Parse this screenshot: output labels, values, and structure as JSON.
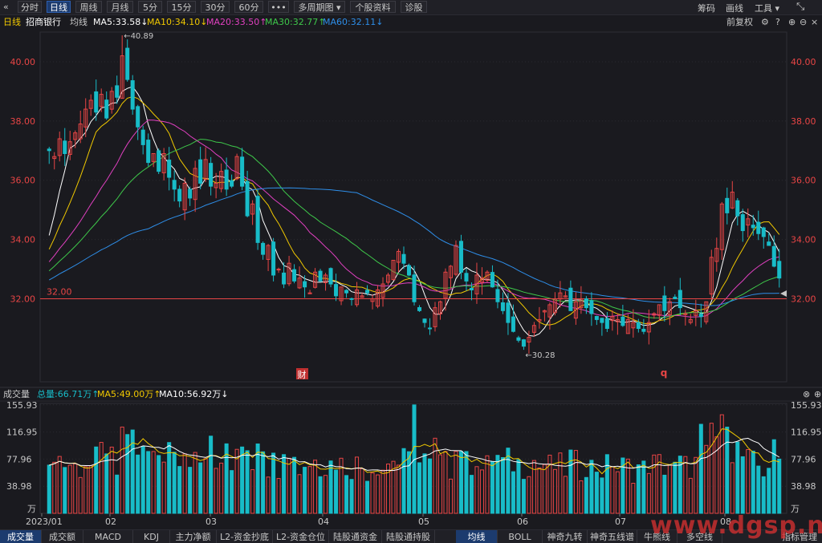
{
  "toolbar": {
    "back_icon": "double-chevron-left-icon",
    "buttons": [
      {
        "label": "分时"
      },
      {
        "label": "日线"
      },
      {
        "label": "周线"
      },
      {
        "label": "月线"
      },
      {
        "label": "5分"
      },
      {
        "label": "15分"
      },
      {
        "label": "30分"
      },
      {
        "label": "60分"
      },
      {
        "label": "•••"
      },
      {
        "label": "多周期图 ▾"
      },
      {
        "label": "个股资料"
      },
      {
        "label": "诊股"
      }
    ],
    "right": {
      "chips": "筹码",
      "draw": "画线",
      "tools": "工具 ▾"
    }
  },
  "stock": {
    "period": "日线",
    "name": "招商银行",
    "ma_label": "均线",
    "ma5": "MA5:33.58↓",
    "ma10": "MA10:34.10↓",
    "ma20": "MA20:33.50↑",
    "ma30": "MA30:32.77↑",
    "ma60": "MA60:32.11↓",
    "fq": "前复权",
    "colors": {
      "ma5": "#ffffff",
      "ma10": "#f0c800",
      "ma20": "#e040c0",
      "ma30": "#3ec84a",
      "ma60": "#2e8ee8",
      "up": "#e84545",
      "down": "#18bcc8"
    }
  },
  "volume_header": {
    "title": "成交量",
    "total": "总量:66.71万↑",
    "ma5": "MA5:49.00万↑",
    "ma10": "MA10:56.92万↓"
  },
  "annotations": {
    "high": "←40.89",
    "low": "←30.28",
    "level": "32.00",
    "cai": "财",
    "q": "q"
  },
  "bottom_tabs": {
    "left": [
      "成交量",
      "成交额",
      "MACD",
      "KDJ",
      "主力净额",
      "L2-资金抄底",
      "L2-资金仓位",
      "陆股通资金",
      "陆股通持股"
    ],
    "right": [
      "均线",
      "BOLL",
      "神奇九转",
      "神奇五线谱",
      "牛熊线",
      "多空线"
    ],
    "settings": "指标管理"
  },
  "watermark": "www.dgsp.net",
  "chart_data": {
    "type": "candlestick",
    "title": "招商银行 日线",
    "x_ticks": [
      "2023/01",
      "02",
      "03",
      "04",
      "05",
      "06",
      "07",
      "08"
    ],
    "price_axis": {
      "ticks": [
        "40.00",
        "38.00",
        "36.00",
        "34.00",
        "32.00"
      ],
      "range": [
        29.2,
        41.0
      ]
    },
    "volume_axis": {
      "ticks": [
        "155.93",
        "116.95",
        "77.96",
        "38.98"
      ],
      "unit": "万",
      "range": [
        0,
        158
      ]
    },
    "reference_line": 32.0,
    "highest": 40.89,
    "lowest": 30.28,
    "closes": [
      37.0,
      36.8,
      37.4,
      36.9,
      37.3,
      37.6,
      37.9,
      38.4,
      38.7,
      38.3,
      38.9,
      38.1,
      39.0,
      38.8,
      40.2,
      39.4,
      38.4,
      37.8,
      37.2,
      36.6,
      36.9,
      36.3,
      36.9,
      36.1,
      35.7,
      35.3,
      35.9,
      35.4,
      36.4,
      35.9,
      36.7,
      35.8,
      35.9,
      36.3,
      35.7,
      35.8,
      36.8,
      35.8,
      34.8,
      35.2,
      33.9,
      33.5,
      33.8,
      32.8,
      33.0,
      32.5,
      33.2,
      32.6,
      32.7,
      32.4,
      32.2,
      32.9,
      32.6,
      32.8,
      32.5,
      32.1,
      32.4,
      32.2,
      32.0,
      32.3,
      32.1,
      32.2,
      32.0,
      32.3,
      32.5,
      32.8,
      33.3,
      33.6,
      33.2,
      32.8,
      31.9,
      31.6,
      31.2,
      31.0,
      31.7,
      31.9,
      32.9,
      33.1,
      33.8,
      32.9,
      32.6,
      32.3,
      32.8,
      32.7,
      32.9,
      32.4,
      31.9,
      31.6,
      31.2,
      30.9,
      30.6,
      30.4,
      30.7,
      31.1,
      31.3,
      31.6,
      31.8,
      32.0,
      32.2,
      32.1,
      31.6,
      31.9,
      32.0,
      31.7,
      31.5,
      31.3,
      31.2,
      31.0,
      31.4,
      31.3,
      31.1,
      31.3,
      31.2,
      31.0,
      30.9,
      31.2,
      31.5,
      31.8,
      31.6,
      31.9,
      32.0,
      31.7,
      31.5,
      31.3,
      31.6,
      31.4,
      31.9,
      33.4,
      33.7,
      35.2,
      34.9,
      35.6,
      34.8,
      34.3,
      34.7,
      34.4,
      34.2,
      34.1,
      33.8,
      33.1,
      32.7
    ]
  }
}
